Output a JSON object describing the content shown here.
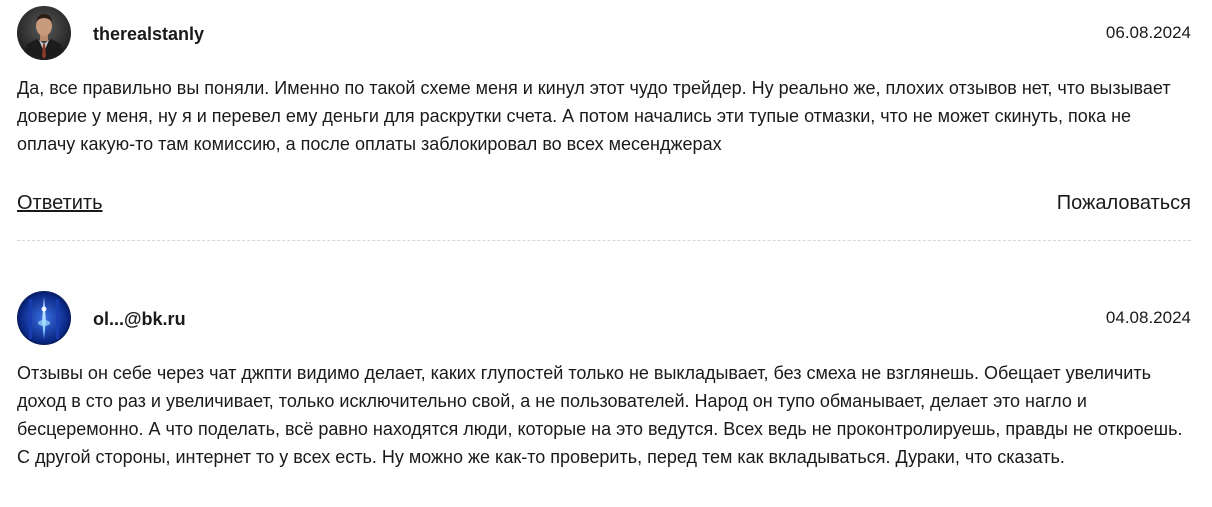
{
  "comments": [
    {
      "author": "therealstanly",
      "avatar_icon": "user-photo-suit-icon",
      "date": "06.08.2024",
      "text": "Да, все правильно вы поняли. Именно по такой схеме меня и кинул этот чудо трейдер. Ну реально же, плохих отзывов нет, что вызывает доверие у меня, ну я и перевел ему деньги для раскрутки счета. А потом начались эти тупые отмазки, что не может скинуть, пока не оплачу какую-то там комиссию, а после оплаты заблокировал во всех месенджерах",
      "reply_label": "Ответить",
      "report_label": "Пожаловаться"
    },
    {
      "author": "ol...@bk.ru",
      "avatar_icon": "user-photo-blue-light-icon",
      "date": "04.08.2024",
      "text": "Отзывы он себе через чат джпти видимо делает, каких глупостей только не выкладывает, без смеха не взглянешь. Обещает увеличить доход в сто раз и увеличивает, только исключительно свой, а не пользователей. Народ он тупо обманывает, делает это нагло и бесцеремонно. А что поделать, всё равно находятся люди, которые на это ведутся. Всех ведь не проконтролируешь, правды не откроешь. С другой стороны, интернет то у всех есть. Ну можно же как-то проверить, перед тем как вкладываться. Дураки, что сказать."
    }
  ],
  "colors": {
    "text": "#1a1a1a",
    "divider": "#d6d6d6",
    "background": "#ffffff"
  }
}
